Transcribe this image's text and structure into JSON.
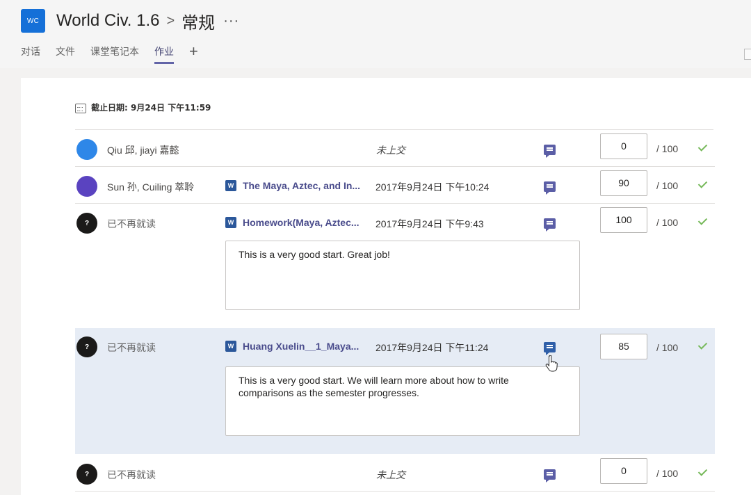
{
  "header": {
    "logo_text": "WC",
    "team_name": "World Civ. 1.6",
    "separator": ">",
    "channel": "常规",
    "more": "···"
  },
  "tabs": [
    {
      "label": "对话",
      "active": false
    },
    {
      "label": "文件",
      "active": false
    },
    {
      "label": "课堂笔记本",
      "active": false
    },
    {
      "label": "作业",
      "active": true
    }
  ],
  "tab_add": "+",
  "due": {
    "text": "截止日期: 9月24日 下午11:59"
  },
  "students": [
    {
      "avatar_color": "#2e87e8",
      "avatar_text": "",
      "name": "Qiu 邱, jiayi 嘉懿",
      "file": "",
      "status": "未上交",
      "score": "0",
      "total": "/ 100"
    },
    {
      "avatar_color": "#5a43c0",
      "avatar_text": "",
      "name": "Sun 孙, Cuiling 萃聆",
      "file": "The Maya, Aztec, and In...",
      "status": "2017年9月24日 下午10:24",
      "score": "90",
      "total": "/ 100"
    },
    {
      "avatar_color": "#1b1a19",
      "avatar_text": "?",
      "name": "已不再就读",
      "file": "Homework(Maya, Aztec...",
      "status": "2017年9月24日 下午9:43",
      "score": "100",
      "total": "/ 100",
      "comment": "This is a very good start. Great job!"
    },
    {
      "avatar_color": "#1b1a19",
      "avatar_text": "?",
      "name": "已不再就读",
      "file": "Huang Xuelin__1_Maya...",
      "status": "2017年9月24日 下午11:24",
      "score": "85",
      "total": "/ 100",
      "comment": "This is a very good start. We will learn more about how to write comparisons as the semester progresses."
    },
    {
      "avatar_color": "#1b1a19",
      "avatar_text": "?",
      "name": "已不再就读",
      "file": "",
      "status": "未上交",
      "score": "0",
      "total": "/ 100"
    }
  ],
  "colors": {
    "accent": "#6264a7",
    "word_blue": "#2b579a",
    "check_green": "#77b95b",
    "highlight": "#e6ecf5"
  }
}
